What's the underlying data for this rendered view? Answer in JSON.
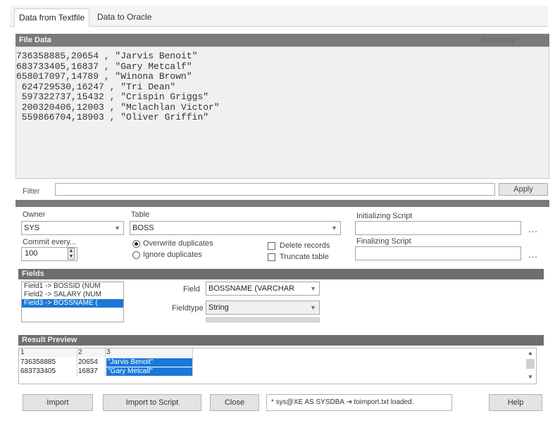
{
  "tabs": [
    "Data from Textfile",
    "Data to Oracle"
  ],
  "file_data": {
    "header": "File Data",
    "encoding_label": "Encoding",
    "lines": [
      "736358885,20654 , \"Jarvis Benoit\"",
      "683733405,16837 , \"Gary Metcalf\"",
      "658017097,14789 , \"Winona Brown\"",
      " 624729530,16247 , \"Tri Dean\"",
      " 597322737,15432 , \"Crispin Griggs\"",
      " 200320406,12003 , \"Mclachlan Victor\"",
      " 559866704,18903 , \"Oliver Griffin\""
    ],
    "filter_label": "Filter",
    "apply_label": "Apply"
  },
  "destination": {
    "owner_label": "Owner",
    "owner_value": "SYS",
    "table_label": "Table",
    "table_value": "BOSS",
    "init_script_label": "Initializing Script",
    "final_script_label": "Finalizing Script",
    "commit_label": "Commit every...",
    "commit_value": "100",
    "overwrite_label": "Overwrite duplicates",
    "ignore_label": "Ignore duplicates",
    "delete_label": "Delete records",
    "truncate_label": "Truncate table",
    "browse_glyph": "..."
  },
  "fields": {
    "header": "Fields",
    "items": [
      "Field1 -> BOSSID (NUM",
      "Field2 -> SALARY (NUM",
      "Field3 -> BOSSNAME ("
    ],
    "field_label": "Field",
    "field_value": "BOSSNAME (VARCHAR",
    "fieldtype_label": "Fieldtype",
    "fieldtype_value": "String"
  },
  "preview": {
    "header": "Result Preview",
    "columns": [
      "1",
      "2",
      "3"
    ],
    "rows": [
      [
        "736358885",
        "20654",
        "\"Jarvis Benoit\""
      ],
      [
        "683733405",
        "16837",
        "\"Gary Metcalf\""
      ]
    ]
  },
  "buttons": {
    "import": "Import",
    "import_script": "Import to Script",
    "close": "Close",
    "help": "Help"
  },
  "status_text": "*  sys@XE AS SYSDBA  ⇥ toimport.txt loaded."
}
